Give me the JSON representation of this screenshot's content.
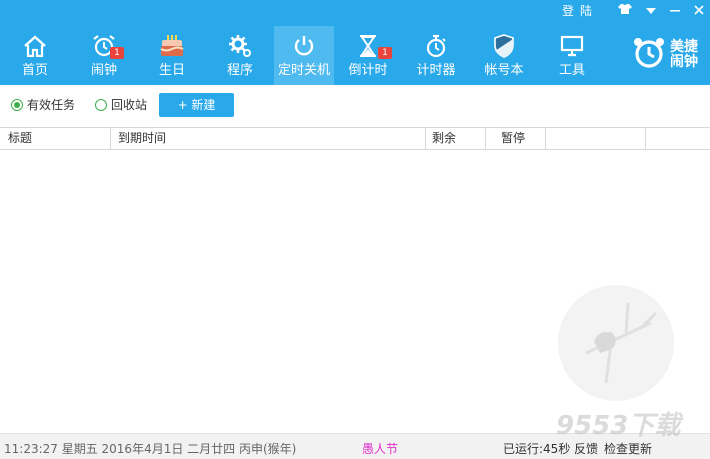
{
  "window": {
    "login_label": "登陆",
    "controls": [
      "skin",
      "menu",
      "minimize",
      "close"
    ]
  },
  "colors": {
    "accent": "#29a8ea",
    "active_tab": "#4fbaf0",
    "badge": "#e8433c",
    "holiday": "#e02fc8",
    "radio": "#3cb04a"
  },
  "nav": {
    "items": [
      {
        "label": "首页",
        "icon": "home-icon"
      },
      {
        "label": "闹钟",
        "icon": "alarm-clock-icon",
        "badge": "1"
      },
      {
        "label": "生日",
        "icon": "cake-icon"
      },
      {
        "label": "程序",
        "icon": "gear-icon"
      },
      {
        "label": "定时关机",
        "icon": "power-icon",
        "active": true
      },
      {
        "label": "倒计时",
        "icon": "hourglass-icon",
        "badge": "1"
      },
      {
        "label": "计时器",
        "icon": "stopwatch-icon"
      },
      {
        "label": "帐号本",
        "icon": "shield-icon"
      },
      {
        "label": "工具",
        "icon": "monitor-icon"
      }
    ],
    "brand": "美捷闹钟"
  },
  "filters": {
    "active_label": "有效任务",
    "recycle_label": "回收站",
    "new_label": "+ 新建"
  },
  "table": {
    "columns": [
      "标题",
      "到期时间",
      "剩余",
      "暂停"
    ],
    "rows": []
  },
  "status": {
    "datetime": "11:23:27  星期五  2016年4月1日  二月廿四  丙申(猴年)",
    "holiday": "愚人节",
    "running": "已运行:45秒",
    "feedback": "反馈",
    "check_update": "检查更新"
  },
  "watermark_text": "9553下载"
}
